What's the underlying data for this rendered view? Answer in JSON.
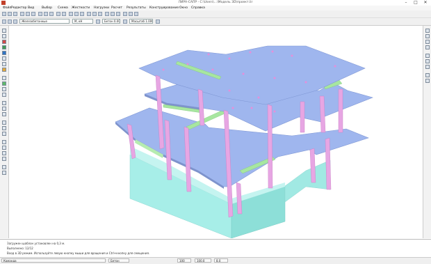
{
  "window": {
    "title": "ЛИРА-САПР - C:\\Users\\...\\Модель 3D\\проект.lir",
    "min": "–",
    "max": "□",
    "close": "✕"
  },
  "menu": [
    "Файл",
    "Редактор",
    "Вид",
    "Выбор",
    "Схема",
    "Жесткости",
    "Нагрузки",
    "Расчет",
    "Результаты",
    "Конструирование",
    "Окно",
    "Справка"
  ],
  "toolbar2": {
    "layer_combo": "Железобетонные",
    "units_combo": "М, кН",
    "value_combo": "Бетон  0.00",
    "scale_combo": "Масштаб  1.000"
  },
  "console": {
    "lines": [
      "Загружен шаблон установлен на 0,3 м.",
      "Выполнено: 12/12",
      "Вход в 3D режим. Используйте левую кнопку мыши для вращения и Ctrl+кнопку для смещения."
    ]
  },
  "status": {
    "command_label": "Команда",
    "field1": "Бетон",
    "field2": "100",
    "field3": "100.0",
    "field4": "8.0"
  },
  "colors": {
    "slab": "#9fb6ee",
    "column": "#e7a6e3",
    "beam": "#a7e6a0",
    "wall": "#a5ece7"
  }
}
